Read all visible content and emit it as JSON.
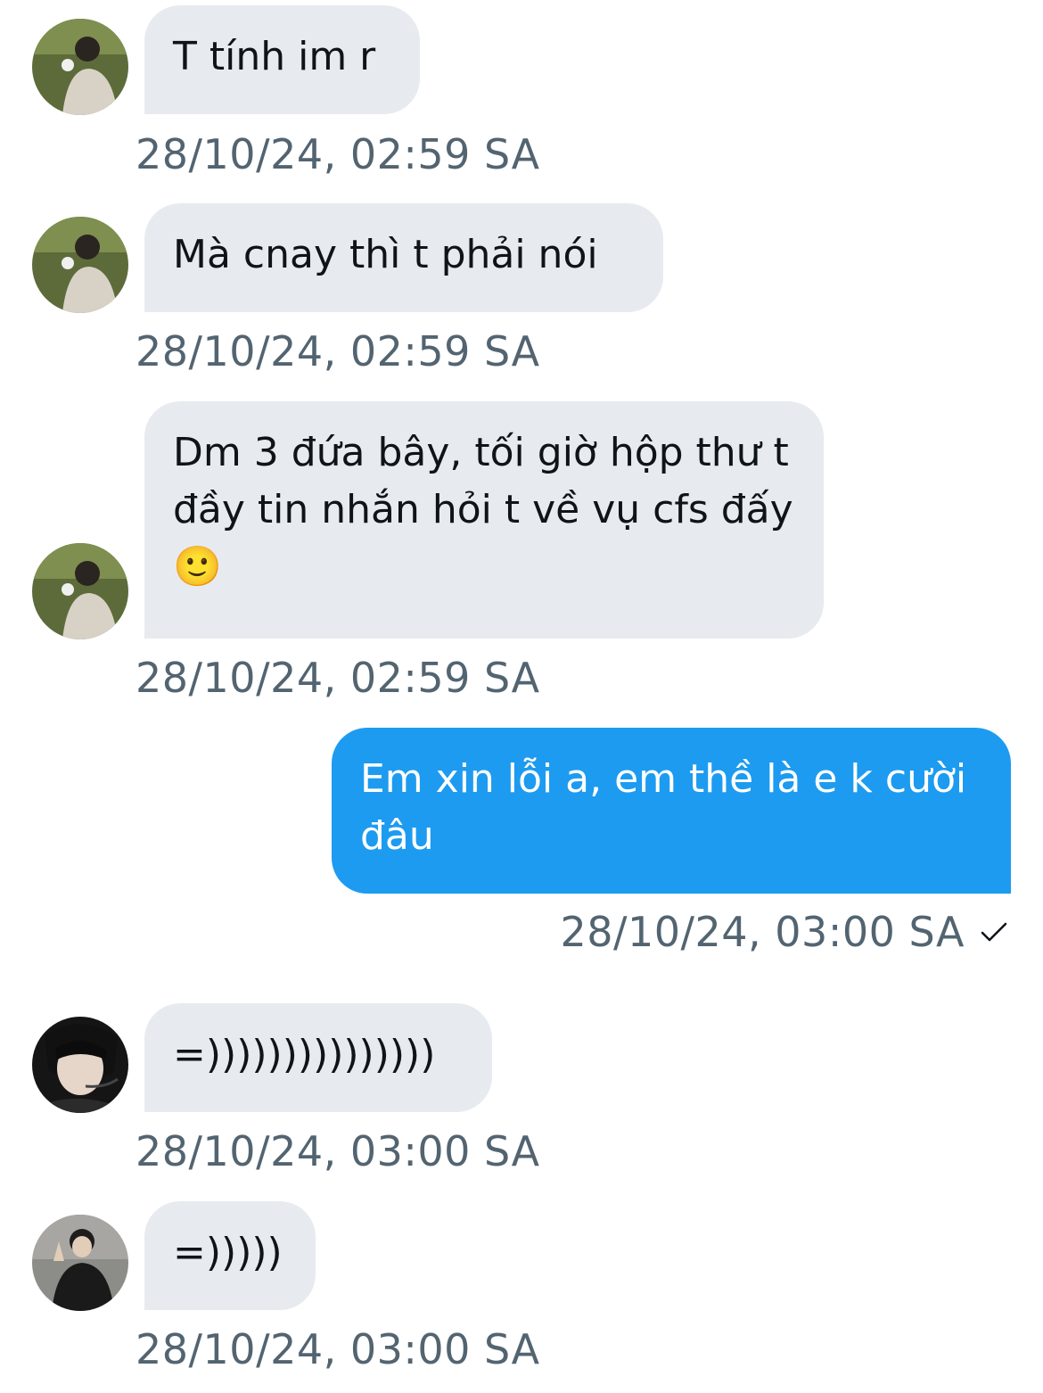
{
  "messages": [
    {
      "text": "T tính im r",
      "time": "28/10/24, 02:59 SA",
      "avatar": "sender-1"
    },
    {
      "text": "Mà cnay thì t phải nói",
      "time": "28/10/24, 02:59 SA",
      "avatar": "sender-1"
    },
    {
      "text": "Dm 3 đứa bây, tối giờ hộp thư t đầy tin nhắn hỏi t về vụ cfs đấy 🙂",
      "time": "28/10/24, 02:59 SA",
      "avatar": "sender-1"
    },
    {
      "text": "Em xin lỗi a, em thề là e k cười đâu",
      "time": "28/10/24, 03:00 SA",
      "outgoing": true,
      "status_icon": "check-icon"
    },
    {
      "text": "=)))))))))))))))",
      "time": "28/10/24, 03:00 SA",
      "avatar": "sender-2"
    },
    {
      "text": "=)))))",
      "time": "28/10/24, 03:00 SA",
      "avatar": "sender-3"
    }
  ],
  "colors": {
    "incoming_bubble": "#e7ebef",
    "outgoing_bubble": "#1d9bf0",
    "timestamp": "#536471"
  }
}
